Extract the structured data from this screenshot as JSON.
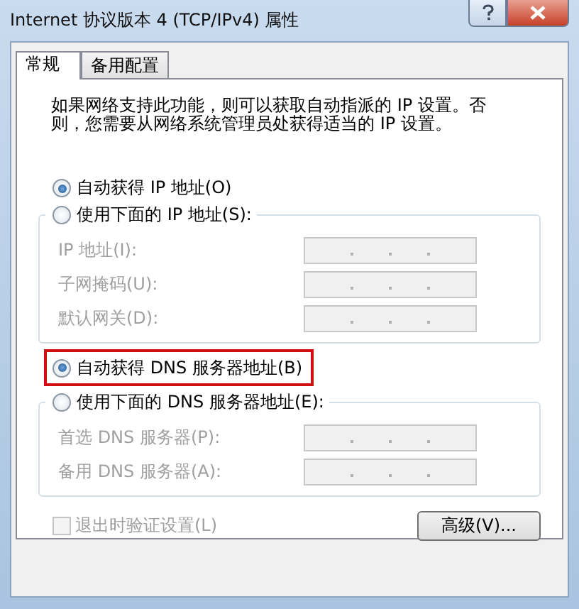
{
  "window": {
    "title": "Internet 协议版本 4 (TCP/IPv4) 属性"
  },
  "tabs": [
    {
      "label": "常规",
      "selected": true
    },
    {
      "label": "备用配置",
      "selected": false
    }
  ],
  "description": "如果网络支持此功能，则可以获取自动指派的 IP 设置。否则，您需要从网络系统管理员处获得适当的 IP 设置。",
  "ip_section": {
    "options": [
      {
        "label": "自动获得 IP 地址(O)",
        "selected": true,
        "highlighted": false
      },
      {
        "label": "使用下面的 IP 地址(S):",
        "selected": false,
        "highlighted": false
      }
    ],
    "fields": [
      {
        "label": "IP 地址(I):",
        "disabled": true
      },
      {
        "label": "子网掩码(U):",
        "disabled": true
      },
      {
        "label": "默认网关(D):",
        "disabled": true
      }
    ]
  },
  "dns_section": {
    "options": [
      {
        "label": "自动获得 DNS 服务器地址(B)",
        "selected": true,
        "highlighted": true
      },
      {
        "label": "使用下面的 DNS 服务器地址(E):",
        "selected": false,
        "highlighted": false
      }
    ],
    "fields": [
      {
        "label": "首选 DNS 服务器(P):",
        "disabled": true
      },
      {
        "label": "备用 DNS 服务器(A):",
        "disabled": true
      }
    ]
  },
  "validate_checkbox": {
    "label": "退出时验证设置(L)",
    "checked": false,
    "disabled": true
  },
  "advanced_button": {
    "label": "高级(V)..."
  }
}
